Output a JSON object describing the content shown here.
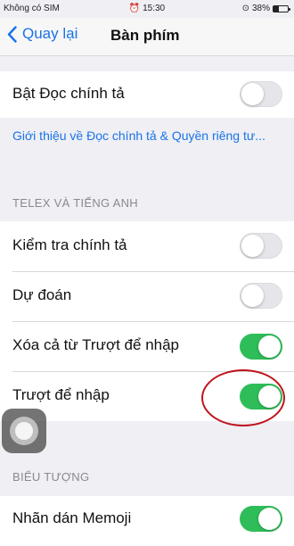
{
  "status_bar": {
    "carrier": "Không có SIM",
    "time": "15:30",
    "battery": "38%",
    "battery_level": 0.38
  },
  "nav": {
    "back_label": "Quay lại",
    "title": "Bàn phím"
  },
  "spell_check_row": {
    "label": "Bật Đọc chính tả",
    "on": false
  },
  "privacy_link": "Giới thiệu về Đọc chính tả & Quyền riêng tư...",
  "section_telex": {
    "header": "TELEX VÀ TIẾNG ANH",
    "items": [
      {
        "label": "Kiểm tra chính tả",
        "on": false
      },
      {
        "label": "Dự đoán",
        "on": false
      },
      {
        "label": "Xóa cả từ Trượt để nhập",
        "on": true
      },
      {
        "label": "Trượt để nhập",
        "on": true
      }
    ]
  },
  "section_symbols": {
    "header": "BIỂU TƯỢNG",
    "items": [
      {
        "label": "Nhãn dán Memoji",
        "on": true
      }
    ]
  },
  "colors": {
    "accent": "#1a73e8",
    "toggle_on": "#2ebd59",
    "annotation": "#c0141c"
  }
}
